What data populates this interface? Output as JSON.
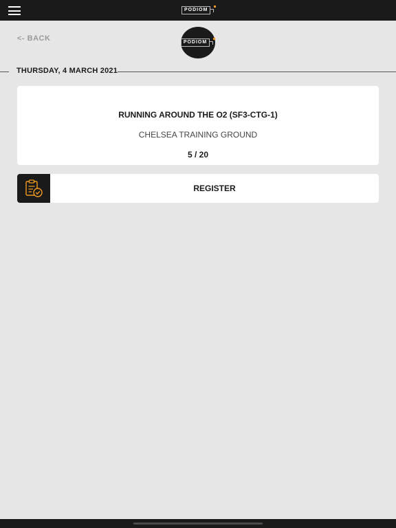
{
  "header": {
    "menu_icon": "hamburger-menu-icon",
    "logo_text": "PODIOM",
    "brand_color": "#f29a1e",
    "bar_color": "#1a1a1a"
  },
  "nav": {
    "back_label": "<- BACK"
  },
  "date_header": "THURSDAY, 4 MARCH 2021",
  "session": {
    "title": "RUNNING AROUND THE O2 (SF3-CTG-1)",
    "location": "CHELSEA TRAINING GROUND",
    "count": "5 / 20"
  },
  "action": {
    "icon": "clipboard-check-icon",
    "register_label": "REGISTER"
  }
}
